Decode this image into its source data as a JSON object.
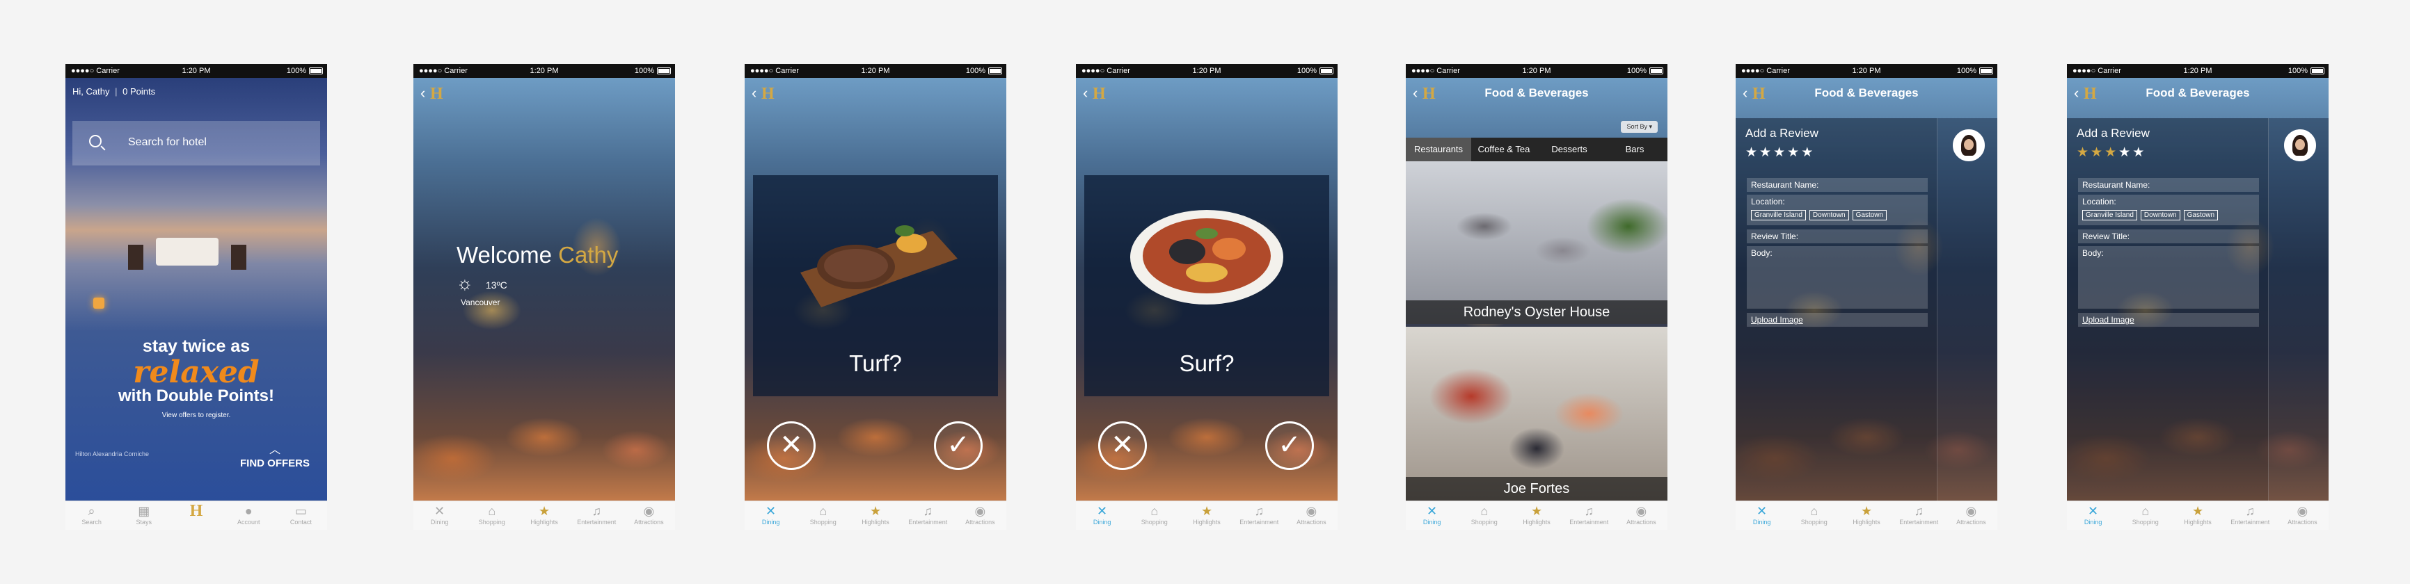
{
  "status": {
    "carrier": "Carrier",
    "time": "1:20 PM",
    "battery": "100%"
  },
  "home": {
    "greeting": "Hi, Cathy",
    "points": "0 Points",
    "search_placeholder": "Search for hotel",
    "promo_line1": "stay twice as",
    "promo_line2": "relaxed",
    "promo_line3": "with Double Points!",
    "promo_sub": "View offers to register.",
    "location": "Hilton Alexandria Corniche",
    "cta": "FIND OFFERS",
    "tabs": [
      {
        "label": "Search",
        "icon": "search-icon"
      },
      {
        "label": "Stays",
        "icon": "calendar-icon"
      },
      {
        "label": "",
        "icon": "hilton-logo-icon"
      },
      {
        "label": "Account",
        "icon": "person-icon"
      },
      {
        "label": "Contact",
        "icon": "chat-icon"
      }
    ]
  },
  "welcome": {
    "word": "Welcome",
    "name": "Cathy",
    "temp": "13ºC",
    "city": "Vancouver"
  },
  "logo": "H",
  "swipe": [
    {
      "caption": "Turf?",
      "dish": "steak"
    },
    {
      "caption": "Surf?",
      "dish": "seafood platter"
    }
  ],
  "app_tabs": [
    {
      "label": "Dining",
      "icon": "fork-knife-icon"
    },
    {
      "label": "Shopping",
      "icon": "shopping-bag-icon"
    },
    {
      "label": "Highlights",
      "icon": "star-icon"
    },
    {
      "label": "Entertainment",
      "icon": "music-note-icon"
    },
    {
      "label": "Attractions",
      "icon": "attractions-icon"
    }
  ],
  "food": {
    "title": "Food & Beverages",
    "sort": "Sort By",
    "tabs": [
      "Restaurants",
      "Coffee & Tea",
      "Desserts",
      "Bars"
    ],
    "restaurants": [
      "Rodney's Oyster House",
      "Joe Fortes"
    ]
  },
  "review": {
    "title": "Add a Review",
    "restaurant_name": "Restaurant Name:",
    "location": "Location:",
    "locations": [
      "Granville Island",
      "Downtown",
      "Gastown"
    ],
    "review_title": "Review Title:",
    "body": "Body:",
    "upload": "Upload Image",
    "rating_a": 0,
    "rating_b": 3,
    "rating_max": 5
  },
  "colors": {
    "accent_gold": "#d4a843",
    "promo_orange": "#f08a1c",
    "active_blue": "#3aa7d9"
  }
}
